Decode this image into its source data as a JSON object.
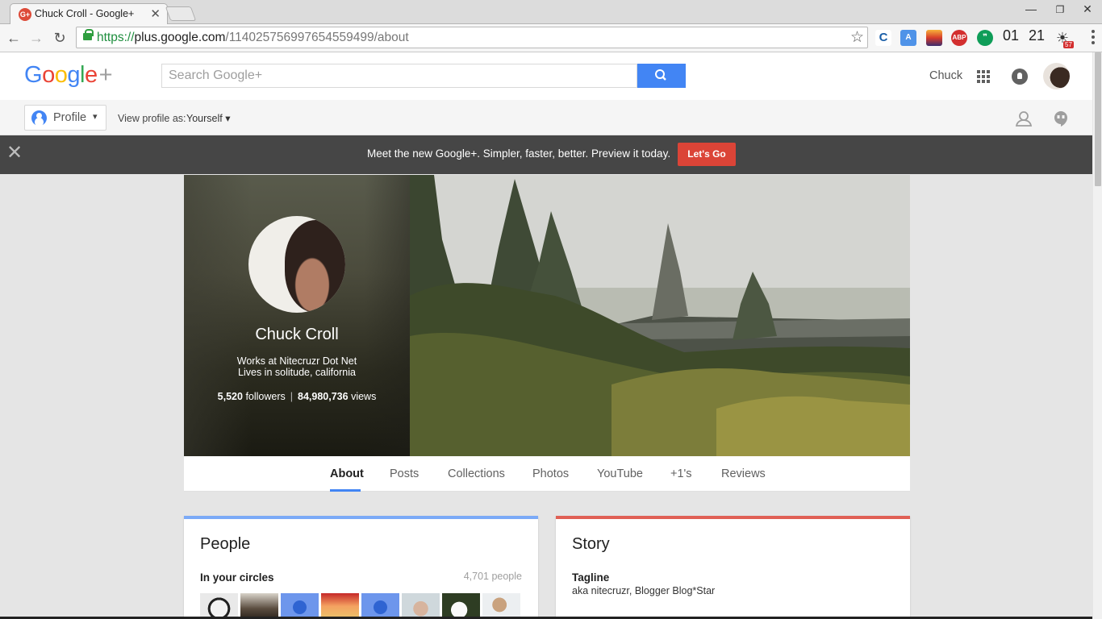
{
  "browser": {
    "tab_title": "Chuck Croll - Google+",
    "favicon_text": "G+",
    "url_scheme": "https://",
    "url_host": "plus.google.com",
    "url_path": "/114025756997654559499/about",
    "clock": "01",
    "clock2": "21",
    "ext_badge": "57",
    "ext_abp": "ABP",
    "ext_c": "C"
  },
  "header": {
    "logo_letters": [
      "G",
      "o",
      "o",
      "g",
      "l",
      "e",
      "+"
    ],
    "logo_colors": [
      "#4285f4",
      "#ea4335",
      "#fbbc05",
      "#4285f4",
      "#34a853",
      "#ea4335",
      "#9e9e9e"
    ],
    "search_placeholder": "Search Google+",
    "user_name": "Chuck"
  },
  "subnav": {
    "profile_label": "Profile",
    "view_as_label": "View profile as:",
    "view_as_value": "Yourself"
  },
  "promo": {
    "text": "Meet the new Google+.   Simpler, faster, better. Preview it today.",
    "button": "Let's Go"
  },
  "profile": {
    "name": "Chuck Croll",
    "work": "Works at Nitecruzr Dot Net",
    "location": "Lives in solitude, california",
    "followers_count": "5,520",
    "followers_label": "followers",
    "views_count": "84,980,736",
    "views_label": "views"
  },
  "tabs": [
    "About",
    "Posts",
    "Collections",
    "Photos",
    "YouTube",
    "+1's",
    "Reviews"
  ],
  "active_tab": "About",
  "people_card": {
    "title": "People",
    "subtitle": "In your circles",
    "count": "4,701 people",
    "accent": "#7baaf7"
  },
  "story_card": {
    "title": "Story",
    "tagline_label": "Tagline",
    "tagline": "aka nitecruzr, Blogger Blog*Star",
    "accent": "#e06055"
  }
}
